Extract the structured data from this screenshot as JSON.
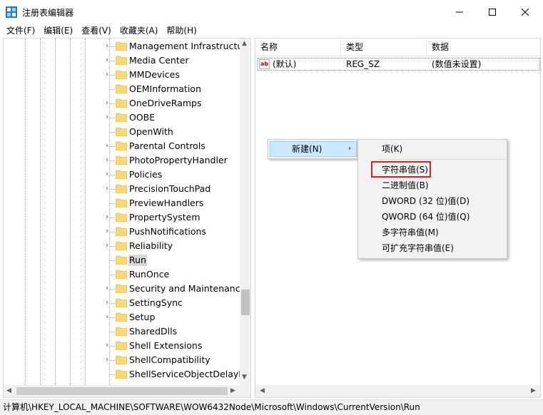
{
  "window": {
    "title": "注册表编辑器"
  },
  "colors": {
    "app_icon": "#1e7ad2",
    "folder": "#f8d775",
    "highlight_box": "#e02020",
    "menu_hover": "#cce8ff"
  },
  "menubar": [
    {
      "label": "文件(F)"
    },
    {
      "label": "编辑(E)"
    },
    {
      "label": "查看(V)"
    },
    {
      "label": "收藏夹(A)"
    },
    {
      "label": "帮助(H)"
    }
  ],
  "tree": {
    "items": [
      {
        "label": "Management Infrastructure",
        "expandable": true,
        "selected": false
      },
      {
        "label": "Media Center",
        "expandable": true,
        "selected": false
      },
      {
        "label": "MMDevices",
        "expandable": true,
        "selected": false
      },
      {
        "label": "OEMInformation",
        "expandable": false,
        "selected": false
      },
      {
        "label": "OneDriveRamps",
        "expandable": true,
        "selected": false
      },
      {
        "label": "OOBE",
        "expandable": true,
        "selected": false
      },
      {
        "label": "OpenWith",
        "expandable": false,
        "selected": false
      },
      {
        "label": "Parental Controls",
        "expandable": true,
        "selected": false
      },
      {
        "label": "PhotoPropertyHandler",
        "expandable": true,
        "selected": false
      },
      {
        "label": "Policies",
        "expandable": true,
        "selected": false
      },
      {
        "label": "PrecisionTouchPad",
        "expandable": true,
        "selected": false
      },
      {
        "label": "PreviewHandlers",
        "expandable": false,
        "selected": false
      },
      {
        "label": "PropertySystem",
        "expandable": true,
        "selected": false
      },
      {
        "label": "PushNotifications",
        "expandable": true,
        "selected": false
      },
      {
        "label": "Reliability",
        "expandable": true,
        "selected": false
      },
      {
        "label": "Run",
        "expandable": false,
        "selected": true
      },
      {
        "label": "RunOnce",
        "expandable": false,
        "selected": false
      },
      {
        "label": "Security and Maintenance",
        "expandable": true,
        "selected": false
      },
      {
        "label": "SettingSync",
        "expandable": true,
        "selected": false
      },
      {
        "label": "Setup",
        "expandable": true,
        "selected": false
      },
      {
        "label": "SharedDlls",
        "expandable": false,
        "selected": false
      },
      {
        "label": "Shell Extensions",
        "expandable": true,
        "selected": false
      },
      {
        "label": "ShellCompatibility",
        "expandable": true,
        "selected": false
      },
      {
        "label": "ShellServiceObjectDelayLoad",
        "expandable": false,
        "selected": false
      }
    ]
  },
  "list": {
    "columns": {
      "name": "名称",
      "type": "类型",
      "data": "数据"
    },
    "rows": [
      {
        "icon": "ab",
        "name": "(默认)",
        "type": "REG_SZ",
        "data": "(数值未设置)"
      }
    ]
  },
  "context_menu": {
    "new_label": "新建(N)",
    "submenu": [
      {
        "label": "项(K)"
      },
      {
        "label": "字符串值(S)"
      },
      {
        "label": "二进制值(B)"
      },
      {
        "label": "DWORD (32 位)值(D)"
      },
      {
        "label": "QWORD (64 位)值(Q)"
      },
      {
        "label": "多字符串值(M)"
      },
      {
        "label": "可扩充字符串值(E)"
      }
    ]
  },
  "statusbar": {
    "path": "计算机\\HKEY_LOCAL_MACHINE\\SOFTWARE\\WOW6432Node\\Microsoft\\Windows\\CurrentVersion\\Run"
  }
}
